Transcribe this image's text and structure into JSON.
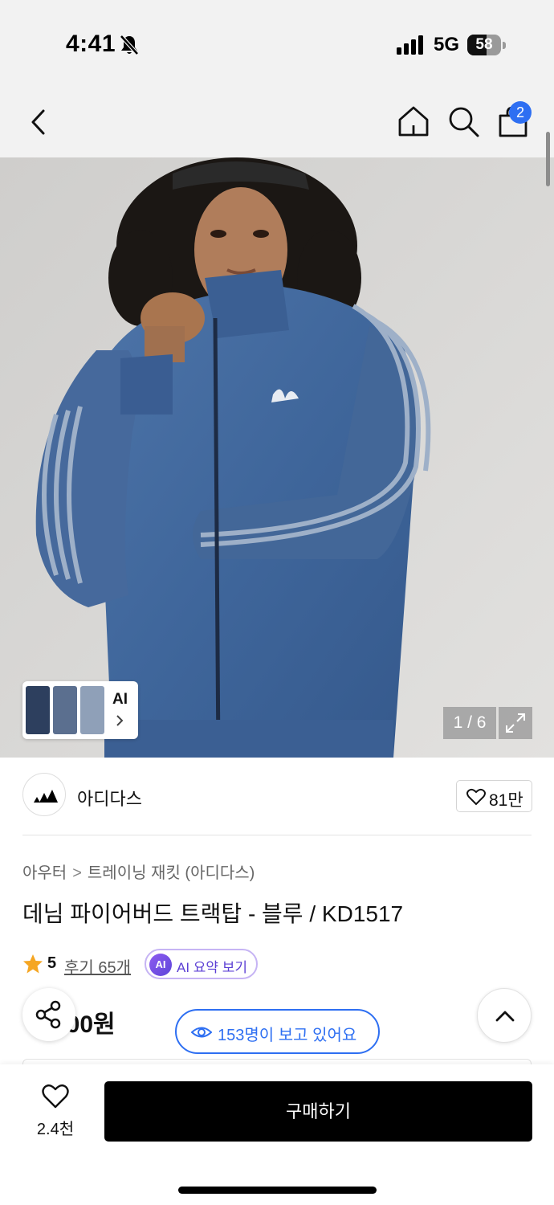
{
  "status_bar": {
    "time": "4:41",
    "network": "5G",
    "battery_percent": "58",
    "battery_level": 0.58,
    "icons": [
      "bell-slash-icon",
      "signal-icon",
      "battery-icon"
    ]
  },
  "nav": {
    "cart_badge": "2",
    "icons": [
      "back-arrow-icon",
      "home-icon",
      "search-icon",
      "shopping-bag-icon"
    ]
  },
  "gallery": {
    "thumb_label": "AI",
    "pager": "1 / 6",
    "icons": [
      "chevron-right-icon",
      "expand-icon"
    ]
  },
  "brand": {
    "name": "아디다스",
    "likes": "81만",
    "icons": [
      "adidas-logo",
      "heart-icon"
    ]
  },
  "breadcrumb": {
    "items": [
      "아우터",
      "트레이닝 재킷 (아디다스)"
    ],
    "separator": ">"
  },
  "product": {
    "title": "데님 파이어버드 트랙탑 - 블루 / KD1517",
    "rating": "5",
    "reviews": "후기 65개",
    "ai_badge": "AI",
    "ai_summary": "AI 요약 보기",
    "price": "000원",
    "viewers": "153명이 보고 있어요"
  },
  "bottom_bar": {
    "wishlist_count": "2.4천",
    "buy_label": "구매하기"
  },
  "colors": {
    "accent_blue": "#2e6ff2",
    "ai_purple": "#5b3fd4",
    "star": "#f5a623",
    "buy_button": "#000000"
  }
}
